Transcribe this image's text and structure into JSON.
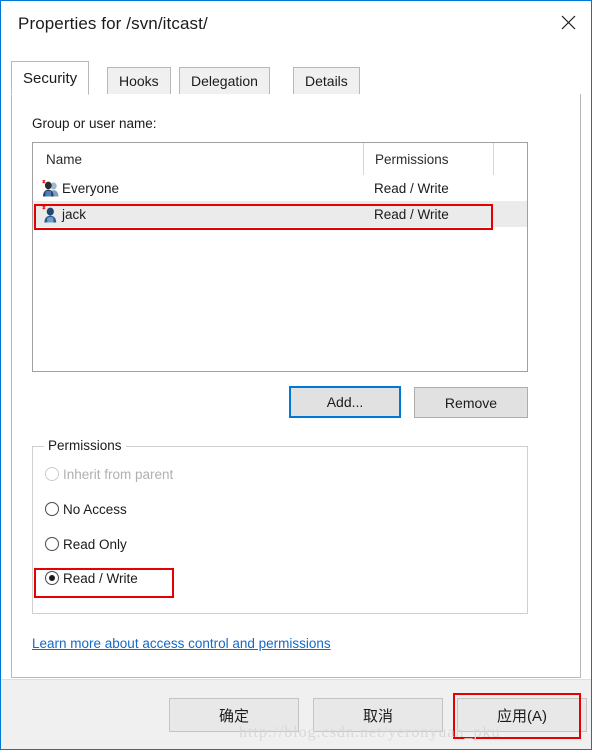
{
  "window": {
    "title": "Properties for /svn/itcast/",
    "close_icon": "close-icon"
  },
  "tabs": [
    {
      "label": "Security",
      "active": true
    },
    {
      "label": "Hooks",
      "active": false
    },
    {
      "label": "Delegation",
      "active": false
    },
    {
      "label": "Details",
      "active": false
    }
  ],
  "security": {
    "list_label": "Group or user name:",
    "columns": [
      "Name",
      "Permissions"
    ],
    "rows": [
      {
        "name": "Everyone",
        "permission": "Read / Write",
        "icon": "group-users-icon",
        "selected": false
      },
      {
        "name": "jack",
        "permission": "Read / Write",
        "icon": "single-user-icon",
        "selected": true
      }
    ],
    "add_label": "Add...",
    "remove_label": "Remove",
    "permissions_group_label": "Permissions",
    "permission_options": [
      {
        "label": "Inherit from parent",
        "checked": false,
        "disabled": true
      },
      {
        "label": "No Access",
        "checked": false,
        "disabled": false
      },
      {
        "label": "Read Only",
        "checked": false,
        "disabled": false
      },
      {
        "label": "Read / Write",
        "checked": true,
        "disabled": false
      }
    ],
    "help_link": "Learn more about access control and permissions"
  },
  "footer": {
    "ok_label": "确定",
    "cancel_label": "取消",
    "apply_label": "应用(A)"
  },
  "watermark": "http://blog.csdn.net/yeronyuan_pku",
  "colors": {
    "accent": "#0078d7",
    "annotation": "#e60000",
    "link": "#1569c7"
  }
}
